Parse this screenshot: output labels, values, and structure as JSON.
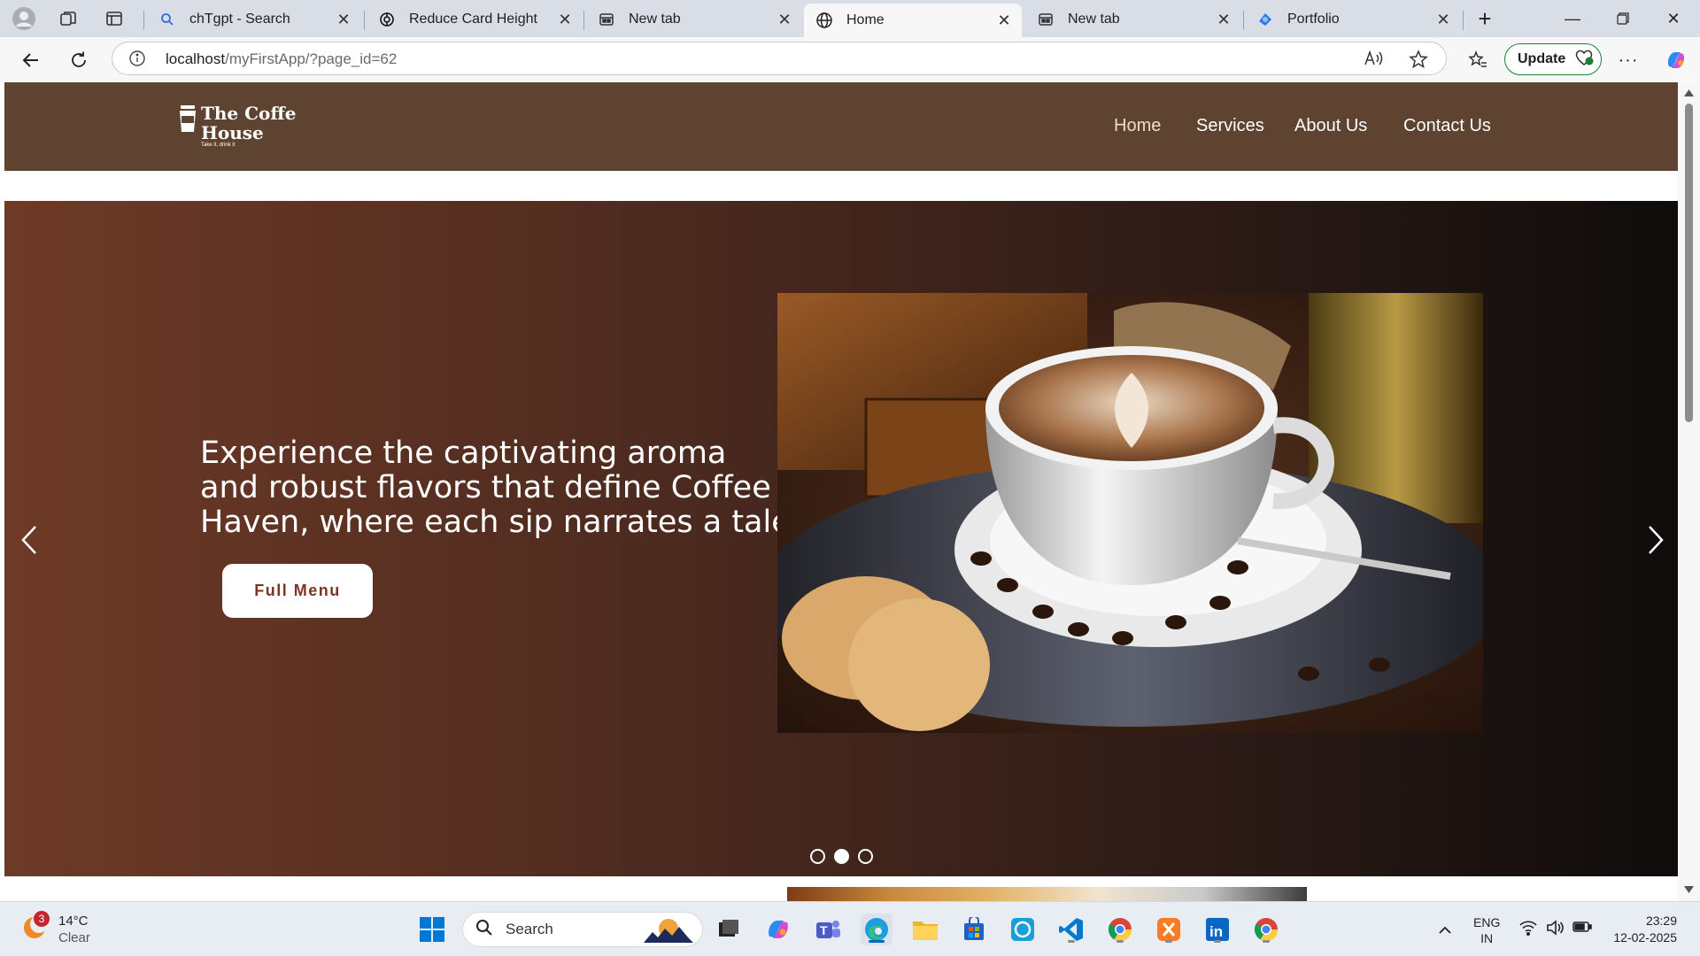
{
  "browser": {
    "tabs": [
      {
        "title": "chTgpt - Search",
        "icon": "search-icon"
      },
      {
        "title": "Reduce Card Height",
        "icon": "openai-icon"
      },
      {
        "title": "New tab",
        "icon": "newtab-icon"
      },
      {
        "title": "Home",
        "icon": "globe-icon",
        "active": true
      },
      {
        "title": "New tab",
        "icon": "newtab-icon"
      },
      {
        "title": "Portfolio",
        "icon": "portfolio-icon"
      }
    ],
    "address": {
      "host": "localhost",
      "path": "/myFirstApp/?page_id=62"
    },
    "update_label": "Update"
  },
  "site": {
    "logo": {
      "line1": "The Coffe",
      "line2": "House",
      "tagline": "Take it, drink it"
    },
    "nav": [
      {
        "label": "Home",
        "active": true
      },
      {
        "label": "Services"
      },
      {
        "label": "About Us"
      },
      {
        "label": "Contact Us"
      }
    ],
    "hero": {
      "headline": "Experience the captivating aroma and robust flavors that define Coffee Haven, where each sip narrates a tale",
      "button_label": "Full Menu",
      "slides_total": 3,
      "active_slide": 2
    },
    "colors": {
      "header_bg": "#5e4430",
      "hero_start": "#6e3a27",
      "hero_end": "#0f0c0c",
      "button_text": "#7a3524"
    }
  },
  "taskbar": {
    "weather": {
      "temp": "14°C",
      "condition": "Clear",
      "badge": "3"
    },
    "search_label": "Search",
    "apps": [
      "task-view-icon",
      "copilot-icon",
      "teams-icon",
      "edge-icon",
      "file-explorer-icon",
      "store-icon",
      "alexa-icon",
      "vscode-icon",
      "chrome-icon",
      "xampp-icon",
      "linkedin-icon",
      "chrome-icon"
    ],
    "lang": {
      "line1": "ENG",
      "line2": "IN"
    },
    "time": "23:29",
    "date": "12-02-2025"
  }
}
